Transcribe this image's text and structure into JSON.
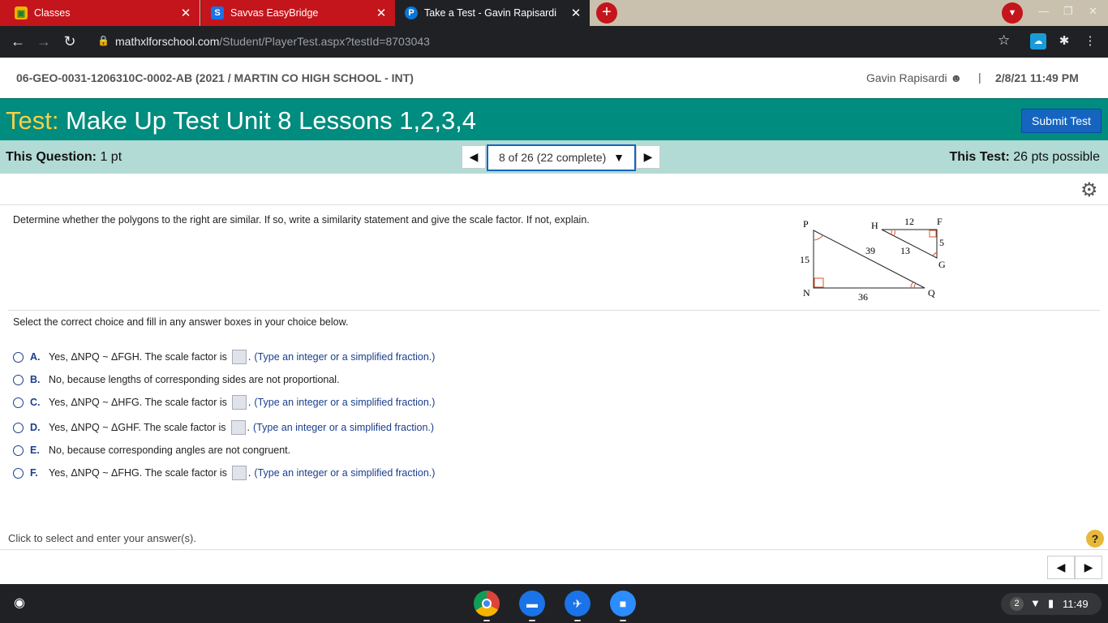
{
  "browser": {
    "tabs": [
      {
        "label": "Classes",
        "active": false,
        "icon": "classroom-icon"
      },
      {
        "label": "Savvas EasyBridge",
        "active": false,
        "icon": "savvas-icon"
      },
      {
        "label": "Take a Test - Gavin Rapisardi",
        "active": true,
        "icon": "pearson-icon"
      }
    ],
    "url_host": "mathxlforschool.com",
    "url_path": "/Student/PlayerTest.aspx?testId=8703043"
  },
  "header": {
    "course": "06-GEO-0031-1206310C-0002-AB (2021 / MARTIN CO HIGH SCHOOL - INT)",
    "user": "Gavin Rapisardi",
    "separator": "|",
    "datetime": "2/8/21 11:49 PM"
  },
  "titlebar": {
    "test_label": "Test:",
    "test_name": "Make Up Test Unit 8 Lessons 1,2,3,4",
    "submit_label": "Submit Test"
  },
  "question_bar": {
    "question_label": "This Question:",
    "question_points": "1 pt",
    "progress": "8 of 26 (22 complete)",
    "test_label": "This Test:",
    "test_points": "26 pts possible"
  },
  "question": {
    "prompt": "Determine whether the polygons to the right are similar. If so, write a similarity statement and give the scale factor. If not, explain.",
    "instruction": "Select the correct choice and fill in any answer boxes in your choice below.",
    "figure": {
      "labels": {
        "P": "P",
        "N": "N",
        "Q": "Q",
        "H": "H",
        "F": "F",
        "G": "G"
      },
      "lengths": {
        "pn": "15",
        "nq": "36",
        "pq": "39",
        "hf": "12",
        "fg": "5",
        "hg": "13"
      }
    },
    "choices": [
      {
        "letter": "A.",
        "before": "Yes, ΔNPQ ~ ΔFGH. The scale factor is",
        "after": ".",
        "hint": "(Type an integer or a simplified fraction.)",
        "has_box": true
      },
      {
        "letter": "B.",
        "before": "No, because lengths of corresponding sides are not proportional.",
        "after": "",
        "hint": "",
        "has_box": false
      },
      {
        "letter": "C.",
        "before": "Yes, ΔNPQ ~ ΔHFG. The scale factor is",
        "after": ".",
        "hint": "(Type an integer or a simplified fraction.)",
        "has_box": true
      },
      {
        "letter": "D.",
        "before": "Yes, ΔNPQ ~ ΔGHF. The scale factor is",
        "after": ".",
        "hint": "(Type an integer or a simplified fraction.)",
        "has_box": true
      },
      {
        "letter": "E.",
        "before": "No, because corresponding angles are not congruent.",
        "after": "",
        "hint": "",
        "has_box": false
      },
      {
        "letter": "F.",
        "before": "Yes, ΔNPQ ~ ΔFHG. The scale factor is",
        "after": ".",
        "hint": "(Type an integer or a simplified fraction.)",
        "has_box": true
      }
    ]
  },
  "footer": {
    "hint": "Click to select and enter your answer(s).",
    "help": "?"
  },
  "shelf": {
    "notification_count": "2",
    "time": "11:49"
  },
  "colors": {
    "titlebar": "#008c7e",
    "test_label": "#f7d046",
    "question_bar": "#b3dbd6",
    "submit": "#1565c0",
    "tab_inactive": "#c4151c",
    "angle_mark": "#d9542b"
  }
}
